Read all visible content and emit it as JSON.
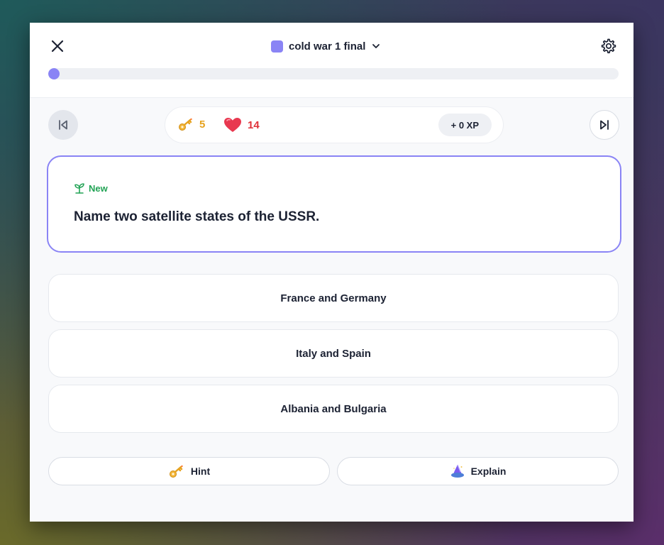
{
  "header": {
    "deck_title": "cold war 1 final",
    "deck_color": "#8a84f5",
    "progress_fraction": 0.0
  },
  "stats": {
    "keys": "5",
    "hearts": "14",
    "xp": "+ 0 XP"
  },
  "question": {
    "tag": "New",
    "text": "Name two satellite states of the USSR."
  },
  "answers": [
    {
      "label": "France and Germany"
    },
    {
      "label": "Italy and Spain"
    },
    {
      "label": "Albania and Bulgaria"
    }
  ],
  "actions": {
    "hint_label": "Hint",
    "explain_label": "Explain"
  },
  "colors": {
    "accent": "#8a84f5",
    "new_tag": "#22a355",
    "keys": "#e6a21e",
    "hearts": "#e0323a"
  },
  "icons": [
    "close-icon",
    "chevron-down-icon",
    "gear-icon",
    "skip-back-icon",
    "skip-forward-icon",
    "key-icon",
    "heart-icon",
    "sprout-icon",
    "magic-hat-icon"
  ]
}
